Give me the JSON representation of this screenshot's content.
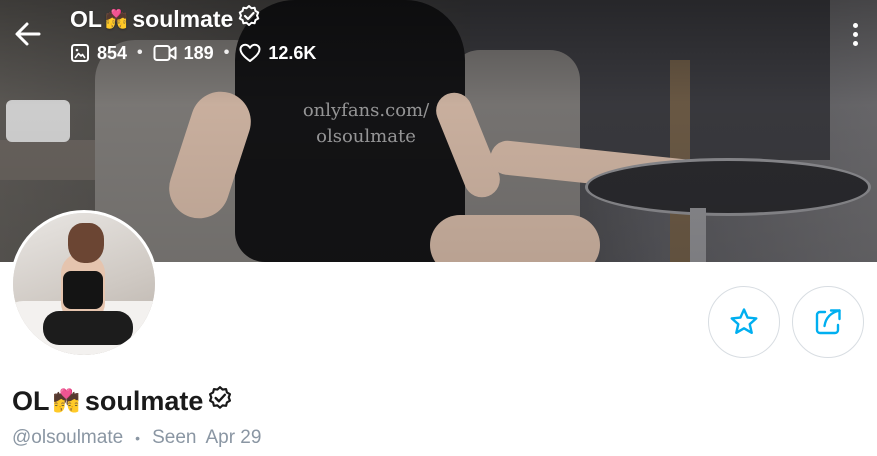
{
  "profile": {
    "name_prefix": "OL",
    "name_emoji": "💏",
    "name_suffix": "soulmate",
    "handle": "@olsoulmate",
    "seen_label": "Seen",
    "seen_date": "Apr 29"
  },
  "header": {
    "stats": [
      {
        "icon": "image-icon",
        "value": "854"
      },
      {
        "icon": "video-icon",
        "value": "189"
      },
      {
        "icon": "heart-icon",
        "value": "12.6K"
      }
    ],
    "separator": "•"
  },
  "cover": {
    "watermark_line1": "onlyfans.com/",
    "watermark_line2": "olsoulmate"
  },
  "actions": {
    "favorite_icon": "star-icon",
    "share_icon": "share-icon"
  },
  "colors": {
    "accent": "#00aff0",
    "muted_text": "#8a96a3",
    "name_text": "#1a1a1a"
  }
}
